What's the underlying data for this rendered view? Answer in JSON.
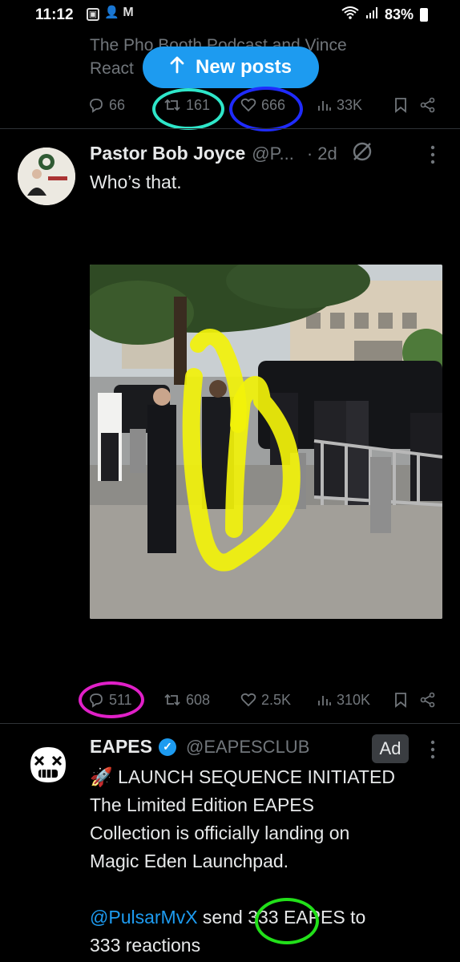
{
  "status_bar": {
    "time": "11:12",
    "battery": "83%",
    "icons": [
      "gallery-icon",
      "person-add-icon",
      "gmail-icon",
      "wifi-icon",
      "signal-icon",
      "battery-icon"
    ]
  },
  "new_posts": {
    "label": "New posts"
  },
  "prev_post": {
    "text_line1": "The Pho    Booth Podcast and Vince",
    "text_line2": "React",
    "replies": "66",
    "reposts": "161",
    "likes": "666",
    "views": "33K"
  },
  "post1": {
    "name": "Pastor Bob Joyce",
    "handle": "@P...",
    "time": "· 2d",
    "text": "Who’s that.",
    "replies": "511",
    "reposts": "608",
    "likes": "2.5K",
    "views": "310K"
  },
  "ad_post": {
    "name": "EAPES",
    "handle": "@EAPESCLUB",
    "badge": "Ad",
    "line1": "🚀 LAUNCH SEQUENCE INITIATED",
    "line2": "The Limited Edition EAPES",
    "line3": "Collection is officially landing on",
    "line4": "Magic Eden Launchpad.",
    "mention": "@PulsarMvX",
    "line5_a": " send ",
    "line5_num": "333",
    "line5_b": " EAPES to",
    "line6": "333 reactions"
  },
  "colors": {
    "accent": "#1d9bf0",
    "annotation_cyan": "#2ee6c9",
    "annotation_blue": "#1f2bff",
    "annotation_magenta": "#e020c8",
    "annotation_green": "#22e01a",
    "annotation_yellow": "#f2f20a"
  }
}
